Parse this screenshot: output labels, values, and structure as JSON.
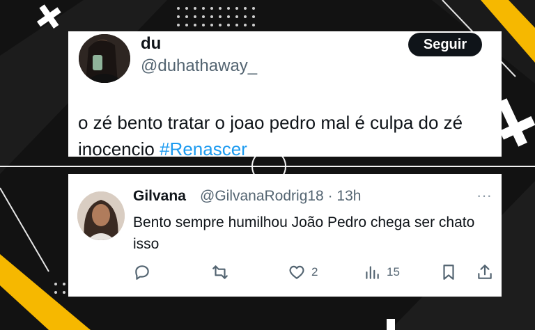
{
  "first_tweet": {
    "display_name": "du",
    "handle": "@duhathaway_",
    "follow_label": "Seguir",
    "text_before_hashtag": "o zé bento tratar o joao pedro mal é culpa do zé inocencio ",
    "hashtag": "#Renascer"
  },
  "reply_tweet": {
    "display_name": "Gilvana",
    "handle_and_time": "@GilvanaRodrig18 · 13h",
    "text": "Bento sempre humilhou João Pedro chega ser chato isso",
    "more_icon": "more-dots-icon",
    "actions": {
      "reply_icon": "reply-icon",
      "retweet_icon": "retweet-icon",
      "like_icon": "heart-icon",
      "like_count": "2",
      "views_icon": "views-icon",
      "views_count": "15",
      "bookmark_icon": "bookmark-icon",
      "share_icon": "share-icon"
    }
  },
  "colors": {
    "background": "#111111",
    "accent_yellow": "#f6b800",
    "link_blue": "#1d9bf0",
    "text_primary": "#0f1419",
    "text_secondary": "#536471"
  }
}
